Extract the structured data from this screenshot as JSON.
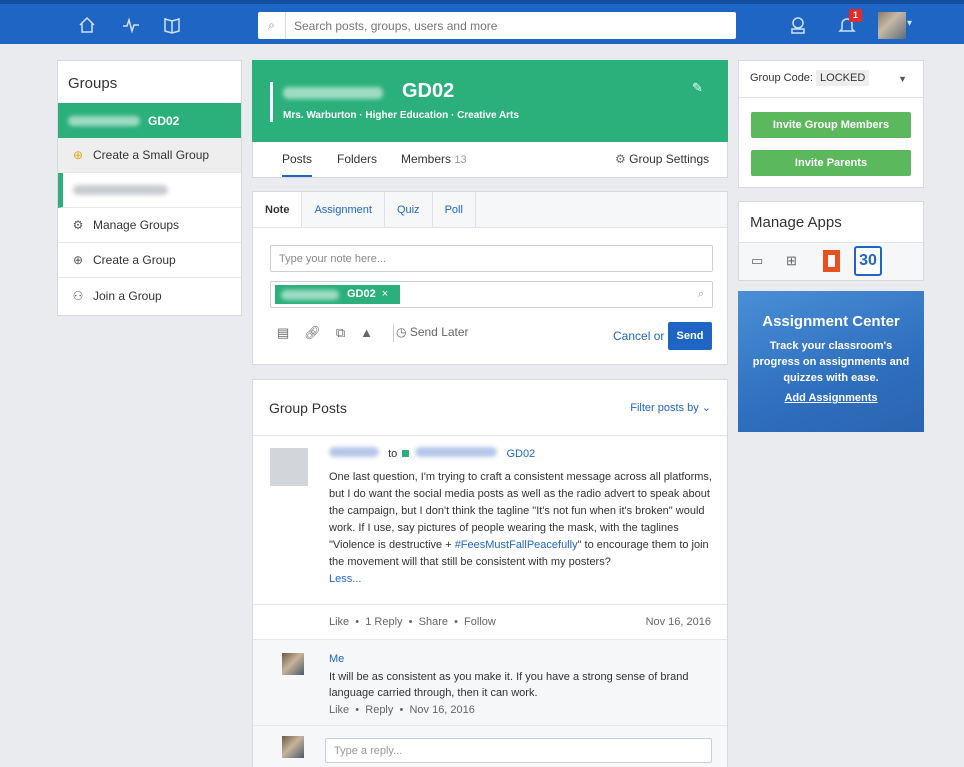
{
  "topbar": {
    "search_placeholder": "Search posts, groups, users and more",
    "notification_count": "1"
  },
  "groups": {
    "title": "Groups",
    "active_group": "GD02",
    "items": [
      {
        "label": "Create a Small Group",
        "icon": "plus-circle-icon"
      },
      {
        "label": "Manage Groups",
        "icon": "gear-icon"
      },
      {
        "label": "Create a Group",
        "icon": "plus-circle-icon"
      },
      {
        "label": "Join a Group",
        "icon": "people-icon"
      }
    ]
  },
  "group_header": {
    "title": "GD02",
    "subtitle": "Mrs. Warburton · Higher Education · Creative Arts",
    "tabs": {
      "posts": "Posts",
      "folders": "Folders",
      "members": "Members",
      "members_count": "13",
      "settings": "Group Settings"
    }
  },
  "composer": {
    "tabs": [
      "Note",
      "Assignment",
      "Quiz",
      "Poll"
    ],
    "note_placeholder": "Type your note here...",
    "recipient": "GD02",
    "send_later": "Send Later",
    "cancel": "Cancel or",
    "send": "Send"
  },
  "posts": {
    "title": "Group Posts",
    "filter": "Filter posts by",
    "post": {
      "to": "to",
      "group": "GD02",
      "body_1": "One last question, I'm trying to craft a consistent message across all platforms, but I do want the social media posts as well as the radio advert to speak about the campaign, but I don't think the tagline \"It's not fun when it's broken\" would work. If I use, say pictures of people wearing the mask, with the taglines \"Violence is destructive + ",
      "hashtag": "#FeesMustFallPeacefully",
      "body_2": "\" to encourage them to join the movement will that still be consistent with my posters?",
      "less": "Less...",
      "actions": "Like  •  1 Reply  •  Share  •  Follow",
      "date": "Nov 16, 2016"
    },
    "reply": {
      "name": "Me",
      "text": "It will be as consistent as you make it. If you have a strong sense of brand language carried through, then it can work.",
      "meta": "Like  •  Reply  •  Nov 16, 2016",
      "placeholder": "Type a reply..."
    }
  },
  "group_code": {
    "label": "Group Code:",
    "value": "LOCKED",
    "invite_members": "Invite Group Members",
    "invite_parents": "Invite Parents"
  },
  "apps": {
    "title": "Manage Apps",
    "calendar_day": "30"
  },
  "assignment_center": {
    "title": "Assignment Center",
    "text": "Track your classroom's progress on assignments and quizzes with ease.",
    "link": "Add Assignments"
  },
  "colors": {
    "brand_blue": "#1f66c4",
    "group_green": "#2bb07c",
    "button_green": "#5bb85c",
    "badge_red": "#e12b2b"
  }
}
